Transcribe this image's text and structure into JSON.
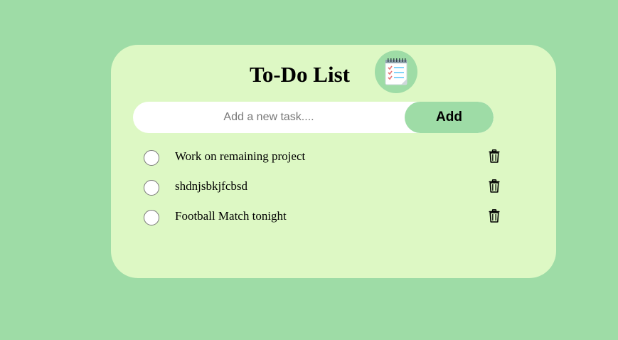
{
  "app": {
    "title": "To-Do List",
    "logo_icon": "notepad-checklist-icon"
  },
  "input": {
    "placeholder": "Add a new task....",
    "value": ""
  },
  "add_button": {
    "label": "Add"
  },
  "tasks": [
    {
      "text": "Work on remaining project",
      "checked": false,
      "delete_icon": "trash-icon"
    },
    {
      "text": "shdnjsbkjfcbsd",
      "checked": false,
      "delete_icon": "trash-icon"
    },
    {
      "text": "Football Match tonight",
      "checked": false,
      "delete_icon": "trash-icon"
    }
  ],
  "colors": {
    "page_background": "#9edca6",
    "card_background": "#ddf8c4",
    "accent": "#9edca6",
    "input_background": "#ffffff"
  }
}
